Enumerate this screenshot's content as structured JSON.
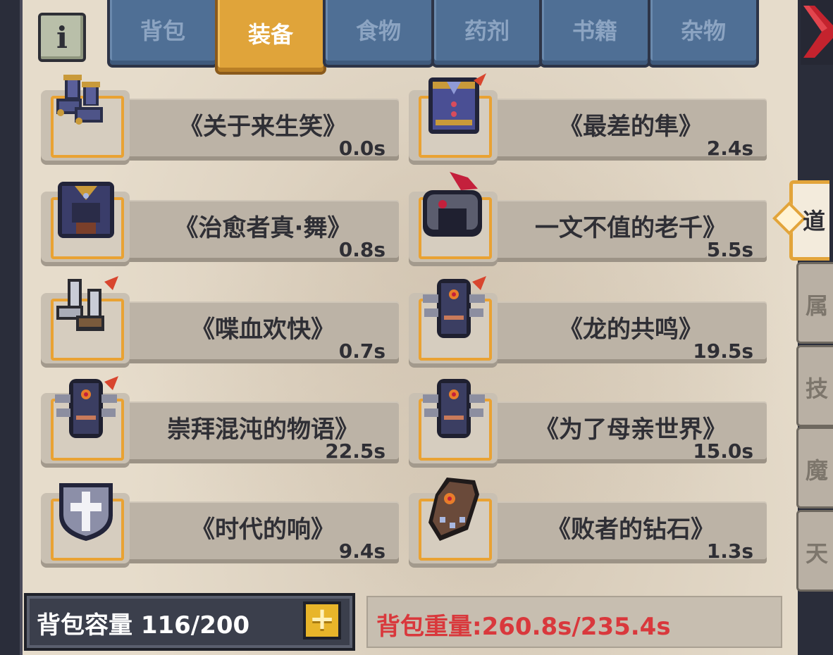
{
  "tabs": [
    {
      "label": "背包",
      "active": false
    },
    {
      "label": "装备",
      "active": true
    },
    {
      "label": "食物",
      "active": false
    },
    {
      "label": "药剂",
      "active": false
    },
    {
      "label": "书籍",
      "active": false
    },
    {
      "label": "杂物",
      "active": false
    }
  ],
  "info_button": {
    "label": "i"
  },
  "items": [
    {
      "name": "《关于来生笑》",
      "weight": "0.0s",
      "icon": "boots-icon"
    },
    {
      "name": "《最差的隼》",
      "weight": "2.4s",
      "icon": "tunic-icon"
    },
    {
      "name": "《治愈者真·舞》",
      "weight": "0.8s",
      "icon": "chest-armor-icon"
    },
    {
      "name": "一文不值的老千》",
      "weight": "5.5s",
      "icon": "crested-helmet-icon"
    },
    {
      "name": "《喋血欢快》",
      "weight": "0.7s",
      "icon": "silver-boots-icon"
    },
    {
      "name": "《龙的共鸣》",
      "weight": "19.5s",
      "icon": "dark-armor-icon"
    },
    {
      "name": "崇拜混沌的物语》",
      "weight": "22.5s",
      "icon": "dark-armor-icon"
    },
    {
      "name": "《为了母亲世界》",
      "weight": "15.0s",
      "icon": "dark-armor-icon"
    },
    {
      "name": "《时代的响》",
      "weight": "9.4s",
      "icon": "cross-shield-icon"
    },
    {
      "name": "《败者的钻石》",
      "weight": "1.3s",
      "icon": "gauntlet-icon"
    }
  ],
  "footer": {
    "capacity_label": "背包容量 116/200",
    "add_button": "+",
    "weight_label": "背包重量:260.8s/235.4s",
    "weight_color": "#d9383c"
  },
  "side_tabs": [
    {
      "label": "道",
      "active": true
    },
    {
      "label": "属",
      "active": false
    },
    {
      "label": "技",
      "active": false
    },
    {
      "label": "魔",
      "active": false
    },
    {
      "label": "天",
      "active": false
    }
  ],
  "colors": {
    "accent": "#e0a43a",
    "tab_inactive": "#4f6f95",
    "panel": "#e6dccb",
    "close": "#c4232e"
  }
}
